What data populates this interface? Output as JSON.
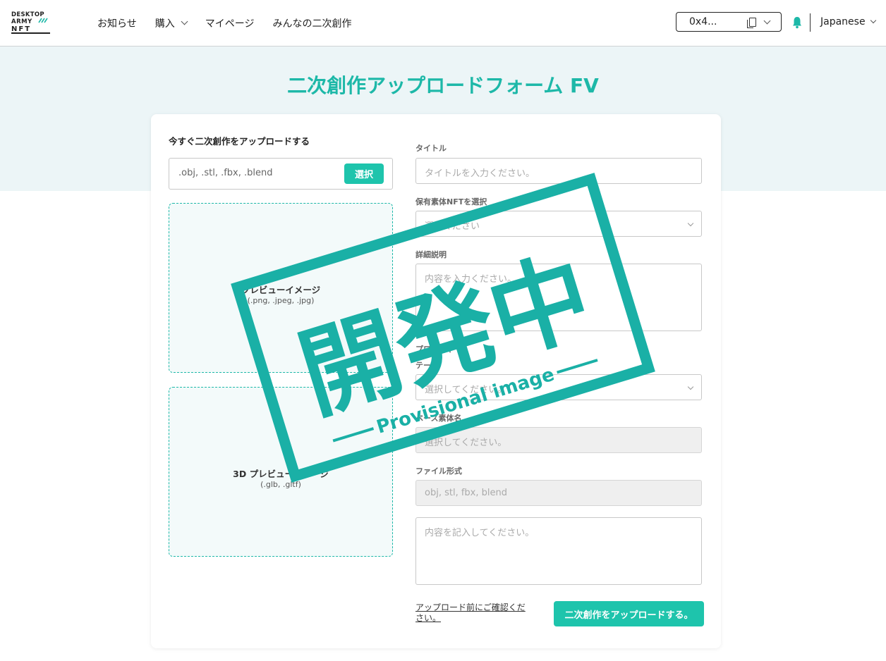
{
  "header": {
    "logo_text": "DESKTOP ARMY NFT",
    "nav": [
      {
        "label": "お知らせ",
        "has_dropdown": false
      },
      {
        "label": "購入",
        "has_dropdown": true
      },
      {
        "label": "マイページ",
        "has_dropdown": false
      },
      {
        "label": "みんなの二次創作",
        "has_dropdown": false
      }
    ],
    "wallet_address": "0x4...",
    "language": "Japanese"
  },
  "page": {
    "title": "二次創作アップロードフォーム FV"
  },
  "upload": {
    "heading": "今すぐ二次創作をアップロードする",
    "file_placeholder": ".obj, .stl, .fbx, .blend",
    "select_button": "選択",
    "preview_label": "プレビューイメージ",
    "preview_formats": "(.png, .jpeg, .jpg)",
    "preview3d_label": "3D プレビューイメージ",
    "preview3d_formats": "(.glb, .gltf)"
  },
  "form": {
    "title_label": "タイトル",
    "title_placeholder": "タイトルを入力ください。",
    "nft_label": "保有素体NFTを選択",
    "nft_placeholder": "選択ください",
    "detail_label": "詳細説明",
    "detail_placeholder": "内容を入力ください。",
    "extra_label": "プロパティ",
    "theme_label": "テーマ",
    "theme_placeholder": "選択してください。",
    "base_label": "ベース素体名",
    "base_placeholder": "選択してください。",
    "format_label": "ファイル形式",
    "format_value": "obj, stl, fbx, blend",
    "note_placeholder": "内容を記入してください。",
    "confirm_link": "アップロード前にご確認ください。",
    "submit_button": "二次創作をアップロードする。"
  },
  "stamp": {
    "main_text": "開発中",
    "sub_text": "Provisional image",
    "color": "#1ab0a6"
  },
  "colors": {
    "accent": "#1ec4ac",
    "hero_bg": "#ecf5f7"
  }
}
